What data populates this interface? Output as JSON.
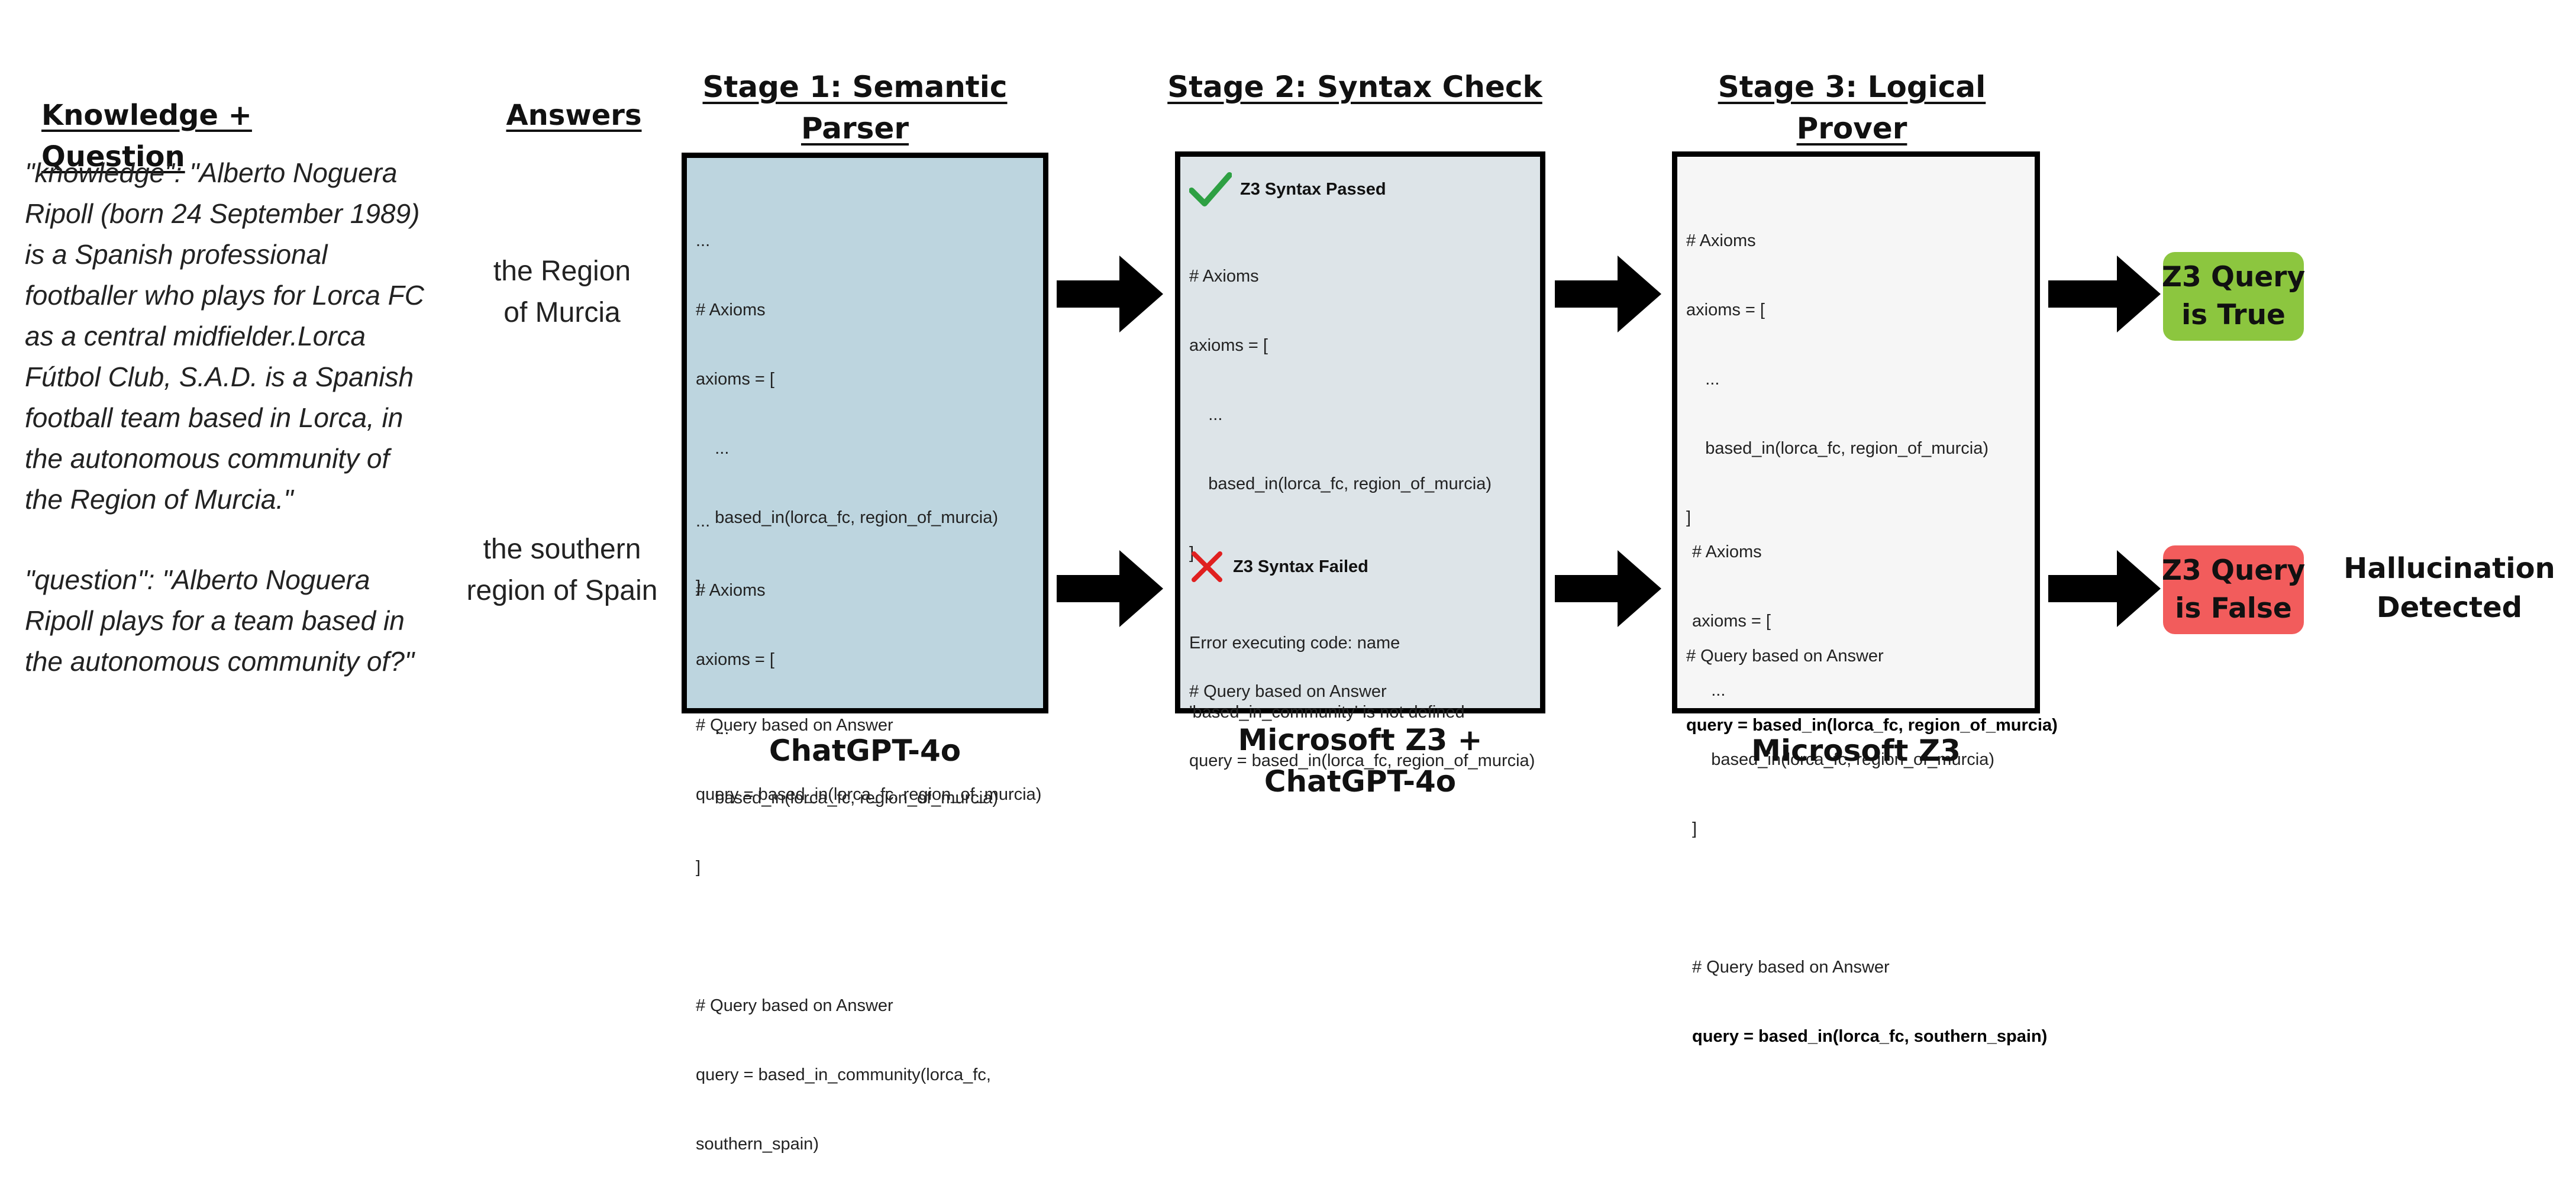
{
  "colors": {
    "stage1_box": "#bdd5df",
    "stage2_box": "#dde4e8",
    "stage3_box": "#f6f6f6",
    "pass_green": "#2ea043",
    "fail_red": "#e02020",
    "result_true": "#8cc63f",
    "result_false": "#f25c5c"
  },
  "columns": {
    "knowledge_question": "Knowledge + Question",
    "answers": "Answers",
    "stage1": "Stage 1: Semantic\nParser",
    "stage2": "Stage 2: Syntax Check",
    "stage3": "Stage 3: Logical\nProver"
  },
  "knowledge_question_text": {
    "knowledge": "\"knowledge\": \"Alberto Noguera\nRipoll (born 24 September 1989)\nis a Spanish professional\nfootballer who plays for Lorca FC\nas a central midfielder.Lorca\nFútbol Club, S.A.D. is a Spanish\nfootball team based in Lorca, in\nthe autonomous community of\nthe Region of Murcia.\"",
    "question": "\"question\": \"Alberto Noguera\nRipoll plays for a team based in\nthe autonomous community of?\""
  },
  "answers": [
    "the Region\nof Murcia",
    "the southern\nregion of Spain"
  ],
  "stage1": {
    "tool": "ChatGPT-4o",
    "top": {
      "l1": "...",
      "l2": "# Axioms",
      "l3": "axioms = [",
      "l4": "    ...",
      "l5": "    based_in(lorca_fc, region_of_murcia)",
      "l6": "]",
      "l7": "# Query based on Answer",
      "l8": "query = based_in(lorca_fc, region_of_murcia)"
    },
    "bottom": {
      "l1": "...",
      "l2": "# Axioms",
      "l3": "axioms = [",
      "l4": "    ...",
      "l5": "    based_in(lorca_fc, region_of_murcia)",
      "l6": "]",
      "l7": "# Query based on Answer",
      "l8": "query = based_in_community(lorca_fc,",
      "l9": "southern_spain)"
    }
  },
  "stage2": {
    "tool": "Microsoft Z3 +\nChatGPT-4o",
    "top": {
      "status_icon": "check-mark-icon",
      "status": "Z3 Syntax Passed",
      "l2": "# Axioms",
      "l3": "axioms = [",
      "l4": "    ...",
      "l5": "    based_in(lorca_fc, region_of_murcia)",
      "l6": "]",
      "l7": "# Query based on Answer",
      "l8": "query = based_in(lorca_fc, region_of_murcia)"
    },
    "bottom": {
      "status_icon": "cross-mark-icon",
      "status": "Z3 Syntax Failed",
      "l1": "Error executing code: name",
      "l2": "'based_in_community' is not defined"
    }
  },
  "stage3": {
    "tool": "Microsoft Z3",
    "top": {
      "l2": "# Axioms",
      "l3": "axioms = [",
      "l4": "    ...",
      "l5": "    based_in(lorca_fc, region_of_murcia)",
      "l6": "]",
      "l7": "# Query based on Answer",
      "l8": "query = based_in(lorca_fc, region_of_murcia)"
    },
    "bottom": {
      "l2": "# Axioms",
      "l3": "axioms = [",
      "l4": "    ...",
      "l5": "    based_in(lorca_fc, region_of_murcia)",
      "l6": "]",
      "l7": "# Query based on Answer",
      "l8": "query = based_in(lorca_fc, southern_spain)"
    }
  },
  "results": {
    "true": "Z3 Query\nis True",
    "false": "Z3 Query\nis False",
    "hallucination": "Hallucination\nDetected"
  }
}
